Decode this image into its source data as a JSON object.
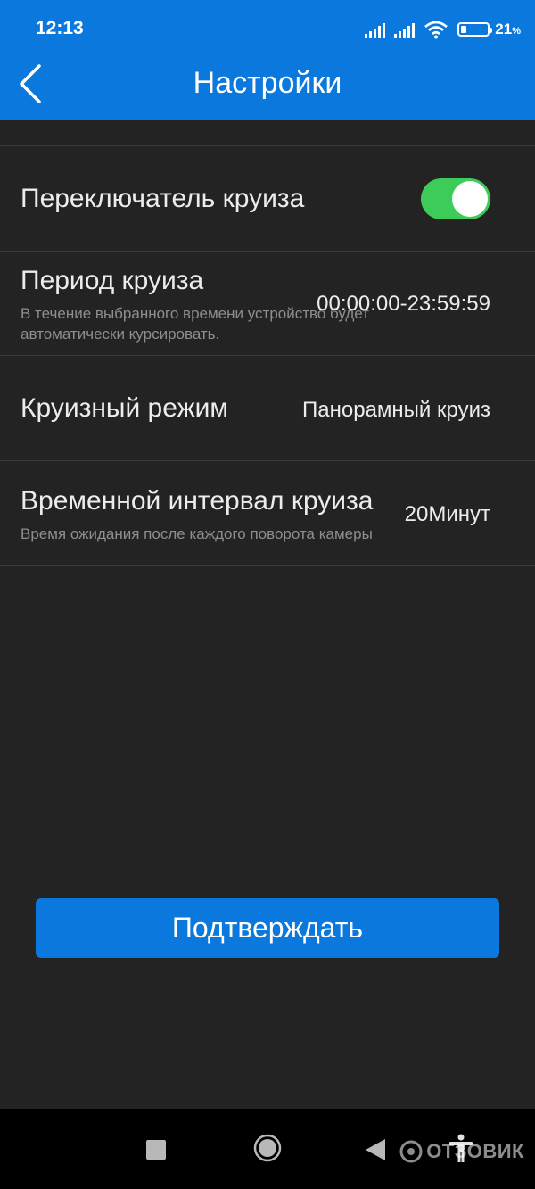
{
  "status_bar": {
    "time": "12:13",
    "battery_percent": "21",
    "battery_percent_sign": "%",
    "battery_level": 0.21,
    "icons": [
      "signal-icon",
      "signal-icon",
      "wifi-icon",
      "battery-icon"
    ]
  },
  "header": {
    "title": "Настройки",
    "back_icon": "chevron-left-icon"
  },
  "settings": {
    "cruise_switch": {
      "label": "Переключатель круиза",
      "enabled": true
    },
    "cruise_period": {
      "label": "Период круиза",
      "subtitle": "В течение выбранного времени устройство будет автоматически курсировать.",
      "value": "00:00:00-23:59:59"
    },
    "cruise_mode": {
      "label": "Круизный режим",
      "value": "Панорамный круиз"
    },
    "cruise_interval": {
      "label": "Временной интервал круиза",
      "subtitle": "Время ожидания после каждого поворота камеры",
      "value": "20Минут"
    }
  },
  "confirm_button": {
    "label": "Подтверждать"
  },
  "navbar": {
    "icons": [
      "recent-apps-icon",
      "home-icon",
      "back-icon",
      "accessibility-icon"
    ]
  },
  "watermark": {
    "text": "ОТЗОВИК"
  },
  "colors": {
    "accent": "#0a78dc",
    "background": "#232323",
    "toggle_on": "#3dcc5a"
  }
}
